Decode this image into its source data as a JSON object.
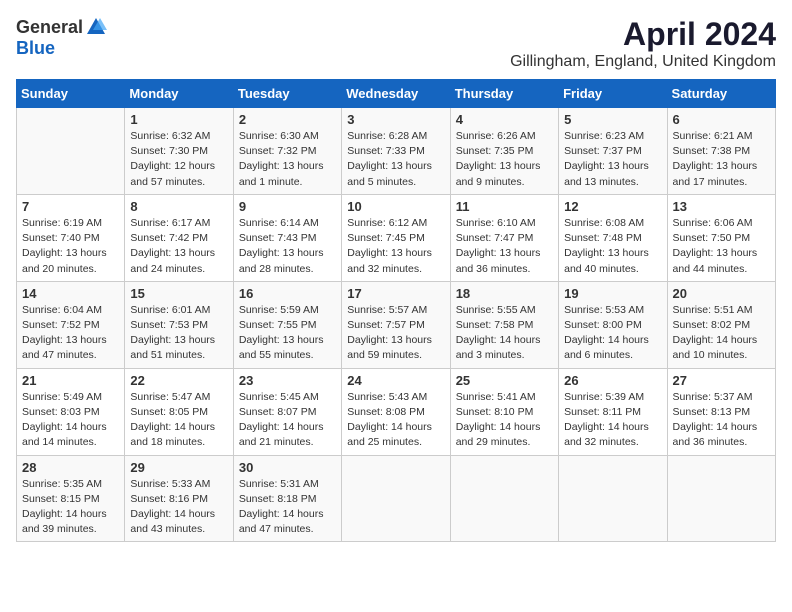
{
  "header": {
    "logo_general": "General",
    "logo_blue": "Blue",
    "title": "April 2024",
    "location": "Gillingham, England, United Kingdom"
  },
  "days_of_week": [
    "Sunday",
    "Monday",
    "Tuesday",
    "Wednesday",
    "Thursday",
    "Friday",
    "Saturday"
  ],
  "weeks": [
    [
      {
        "day": "",
        "info": ""
      },
      {
        "day": "1",
        "info": "Sunrise: 6:32 AM\nSunset: 7:30 PM\nDaylight: 12 hours\nand 57 minutes."
      },
      {
        "day": "2",
        "info": "Sunrise: 6:30 AM\nSunset: 7:32 PM\nDaylight: 13 hours\nand 1 minute."
      },
      {
        "day": "3",
        "info": "Sunrise: 6:28 AM\nSunset: 7:33 PM\nDaylight: 13 hours\nand 5 minutes."
      },
      {
        "day": "4",
        "info": "Sunrise: 6:26 AM\nSunset: 7:35 PM\nDaylight: 13 hours\nand 9 minutes."
      },
      {
        "day": "5",
        "info": "Sunrise: 6:23 AM\nSunset: 7:37 PM\nDaylight: 13 hours\nand 13 minutes."
      },
      {
        "day": "6",
        "info": "Sunrise: 6:21 AM\nSunset: 7:38 PM\nDaylight: 13 hours\nand 17 minutes."
      }
    ],
    [
      {
        "day": "7",
        "info": "Sunrise: 6:19 AM\nSunset: 7:40 PM\nDaylight: 13 hours\nand 20 minutes."
      },
      {
        "day": "8",
        "info": "Sunrise: 6:17 AM\nSunset: 7:42 PM\nDaylight: 13 hours\nand 24 minutes."
      },
      {
        "day": "9",
        "info": "Sunrise: 6:14 AM\nSunset: 7:43 PM\nDaylight: 13 hours\nand 28 minutes."
      },
      {
        "day": "10",
        "info": "Sunrise: 6:12 AM\nSunset: 7:45 PM\nDaylight: 13 hours\nand 32 minutes."
      },
      {
        "day": "11",
        "info": "Sunrise: 6:10 AM\nSunset: 7:47 PM\nDaylight: 13 hours\nand 36 minutes."
      },
      {
        "day": "12",
        "info": "Sunrise: 6:08 AM\nSunset: 7:48 PM\nDaylight: 13 hours\nand 40 minutes."
      },
      {
        "day": "13",
        "info": "Sunrise: 6:06 AM\nSunset: 7:50 PM\nDaylight: 13 hours\nand 44 minutes."
      }
    ],
    [
      {
        "day": "14",
        "info": "Sunrise: 6:04 AM\nSunset: 7:52 PM\nDaylight: 13 hours\nand 47 minutes."
      },
      {
        "day": "15",
        "info": "Sunrise: 6:01 AM\nSunset: 7:53 PM\nDaylight: 13 hours\nand 51 minutes."
      },
      {
        "day": "16",
        "info": "Sunrise: 5:59 AM\nSunset: 7:55 PM\nDaylight: 13 hours\nand 55 minutes."
      },
      {
        "day": "17",
        "info": "Sunrise: 5:57 AM\nSunset: 7:57 PM\nDaylight: 13 hours\nand 59 minutes."
      },
      {
        "day": "18",
        "info": "Sunrise: 5:55 AM\nSunset: 7:58 PM\nDaylight: 14 hours\nand 3 minutes."
      },
      {
        "day": "19",
        "info": "Sunrise: 5:53 AM\nSunset: 8:00 PM\nDaylight: 14 hours\nand 6 minutes."
      },
      {
        "day": "20",
        "info": "Sunrise: 5:51 AM\nSunset: 8:02 PM\nDaylight: 14 hours\nand 10 minutes."
      }
    ],
    [
      {
        "day": "21",
        "info": "Sunrise: 5:49 AM\nSunset: 8:03 PM\nDaylight: 14 hours\nand 14 minutes."
      },
      {
        "day": "22",
        "info": "Sunrise: 5:47 AM\nSunset: 8:05 PM\nDaylight: 14 hours\nand 18 minutes."
      },
      {
        "day": "23",
        "info": "Sunrise: 5:45 AM\nSunset: 8:07 PM\nDaylight: 14 hours\nand 21 minutes."
      },
      {
        "day": "24",
        "info": "Sunrise: 5:43 AM\nSunset: 8:08 PM\nDaylight: 14 hours\nand 25 minutes."
      },
      {
        "day": "25",
        "info": "Sunrise: 5:41 AM\nSunset: 8:10 PM\nDaylight: 14 hours\nand 29 minutes."
      },
      {
        "day": "26",
        "info": "Sunrise: 5:39 AM\nSunset: 8:11 PM\nDaylight: 14 hours\nand 32 minutes."
      },
      {
        "day": "27",
        "info": "Sunrise: 5:37 AM\nSunset: 8:13 PM\nDaylight: 14 hours\nand 36 minutes."
      }
    ],
    [
      {
        "day": "28",
        "info": "Sunrise: 5:35 AM\nSunset: 8:15 PM\nDaylight: 14 hours\nand 39 minutes."
      },
      {
        "day": "29",
        "info": "Sunrise: 5:33 AM\nSunset: 8:16 PM\nDaylight: 14 hours\nand 43 minutes."
      },
      {
        "day": "30",
        "info": "Sunrise: 5:31 AM\nSunset: 8:18 PM\nDaylight: 14 hours\nand 47 minutes."
      },
      {
        "day": "",
        "info": ""
      },
      {
        "day": "",
        "info": ""
      },
      {
        "day": "",
        "info": ""
      },
      {
        "day": "",
        "info": ""
      }
    ]
  ]
}
